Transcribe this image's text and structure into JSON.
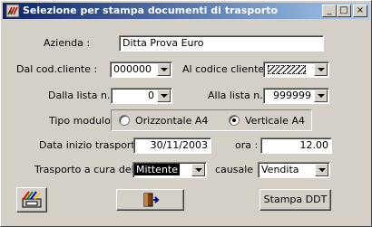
{
  "window": {
    "title": "Selezione per stampa documenti di trasporto",
    "minimize_glyph": "_",
    "maximize_glyph": "□",
    "close_glyph": "×"
  },
  "form": {
    "azienda": {
      "label": "Azienda :",
      "value": "Ditta Prova Euro"
    },
    "dal_cod_cliente": {
      "label": "Dal cod.cliente :",
      "value": "000000"
    },
    "al_codice_cliente": {
      "label": "Al codice cliente :",
      "value": ""
    },
    "dalla_lista": {
      "label": "Dalla lista n. :",
      "value": "0"
    },
    "alla_lista": {
      "label": "Alla lista n. :",
      "value": "999999"
    },
    "tipo_modulo": {
      "label": "Tipo modulo",
      "options": [
        "Orizzontale A4",
        "Verticale A4"
      ],
      "selected": "Verticale A4"
    },
    "data_inizio_trasporto": {
      "label": "Data inizio trasporto :",
      "value": "30/11/2003"
    },
    "ora": {
      "label": "ora :",
      "value": "12.00"
    },
    "trasporto_a_cura_del": {
      "label": "Trasporto a cura del :",
      "value": "Mittente"
    },
    "causale": {
      "label": "causale :",
      "value": "Vendita"
    }
  },
  "buttons": {
    "preview_icon": "printer-color-icon",
    "exit_icon": "exit-door-icon",
    "stampa_label": "Stampa DDT"
  }
}
